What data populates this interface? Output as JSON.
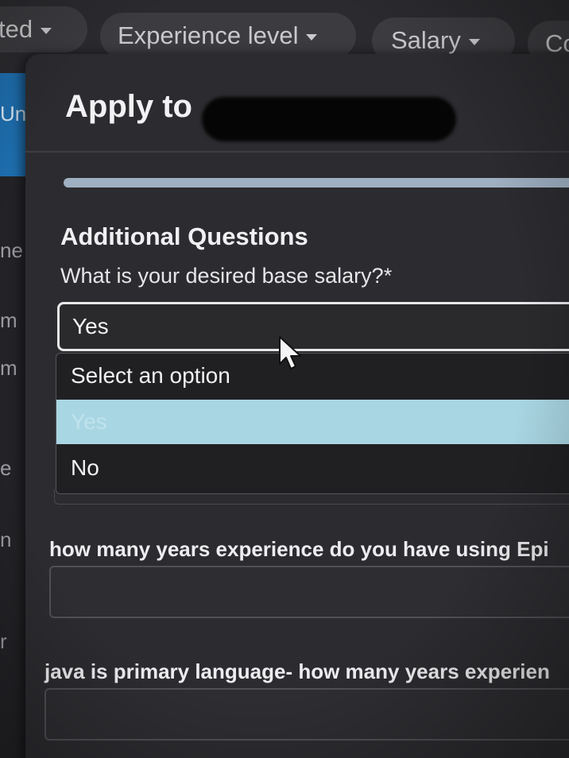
{
  "filters": [
    {
      "label": "ted"
    },
    {
      "label": "Experience level"
    },
    {
      "label": "Salary"
    },
    {
      "label": "Co"
    }
  ],
  "background_fragments": [
    "Uni",
    "ne",
    "m",
    "m",
    "e",
    "n",
    "r"
  ],
  "modal": {
    "title": "Apply to",
    "progress_fraction": 1.0,
    "section_heading": "Additional Questions",
    "questions": [
      {
        "label": "What is your desired base salary?*",
        "selected_value": "Yes",
        "options": [
          "Select an option",
          "Yes",
          "No"
        ],
        "highlighted_option": "Yes"
      },
      {
        "label": "how many years experience do you have using Epi",
        "value": ""
      },
      {
        "label": "java is primary language- how many years experien",
        "value": ""
      }
    ]
  },
  "colors": {
    "modal_bg": "#2c2c30",
    "highlight": "#a9d6e3",
    "accent_blue": "#1e6fb0"
  },
  "icons": {
    "caret": "chevron-down-icon",
    "pointer": "mouse-cursor-icon"
  }
}
